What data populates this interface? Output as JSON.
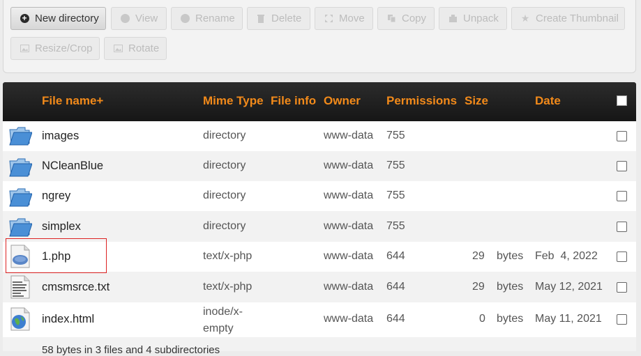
{
  "toolbar": {
    "buttons": [
      {
        "label": "New directory",
        "icon": "plus-circle-icon",
        "enabled": true
      },
      {
        "label": "View",
        "icon": "search-icon",
        "enabled": false
      },
      {
        "label": "Rename",
        "icon": "check-circle-icon",
        "enabled": false
      },
      {
        "label": "Delete",
        "icon": "trash-icon",
        "enabled": false
      },
      {
        "label": "Move",
        "icon": "move-icon",
        "enabled": false
      },
      {
        "label": "Copy",
        "icon": "copy-icon",
        "enabled": false
      },
      {
        "label": "Unpack",
        "icon": "unpack-icon",
        "enabled": false
      },
      {
        "label": "Create Thumbnail",
        "icon": "star-icon",
        "enabled": false
      },
      {
        "label": "Resize/Crop",
        "icon": "image-icon",
        "enabled": false
      },
      {
        "label": "Rotate",
        "icon": "image-icon",
        "enabled": false
      }
    ]
  },
  "table": {
    "headers": {
      "name": "File name+",
      "mime": "Mime Type",
      "info": "File info",
      "owner": "Owner",
      "perms": "Permissions",
      "size": "Size",
      "date": "Date"
    },
    "rows": [
      {
        "icon": "folder-icon",
        "name": "images",
        "mime": "directory",
        "owner": "www-data",
        "perms": "755",
        "size": "",
        "unit": "",
        "date": ""
      },
      {
        "icon": "folder-icon",
        "name": "NCleanBlue",
        "mime": "directory",
        "owner": "www-data",
        "perms": "755",
        "size": "",
        "unit": "",
        "date": ""
      },
      {
        "icon": "folder-icon",
        "name": "ngrey",
        "mime": "directory",
        "owner": "www-data",
        "perms": "755",
        "size": "",
        "unit": "",
        "date": ""
      },
      {
        "icon": "folder-icon",
        "name": "simplex",
        "mime": "directory",
        "owner": "www-data",
        "perms": "755",
        "size": "",
        "unit": "",
        "date": ""
      },
      {
        "icon": "php-file-icon",
        "name": "1.php",
        "mime": "text/x-php",
        "owner": "www-data",
        "perms": "644",
        "size": "29",
        "unit": "bytes",
        "date": "Feb  4, 2022"
      },
      {
        "icon": "text-file-icon",
        "name": "cmsmsrce.txt",
        "mime": "text/x-php",
        "owner": "www-data",
        "perms": "644",
        "size": "29",
        "unit": "bytes",
        "date": "May 12, 2021"
      },
      {
        "icon": "html-file-icon",
        "name": "index.html",
        "mime": "inode/x-empty",
        "owner": "www-data",
        "perms": "644",
        "size": "0",
        "unit": "bytes",
        "date": "May 11, 2021"
      }
    ],
    "summary": "58 bytes in 3 files and 4 subdirectories"
  },
  "colors": {
    "header_text": "#f28a1a",
    "header_bg": "#1e1e1e",
    "highlight": "#dd2222"
  }
}
